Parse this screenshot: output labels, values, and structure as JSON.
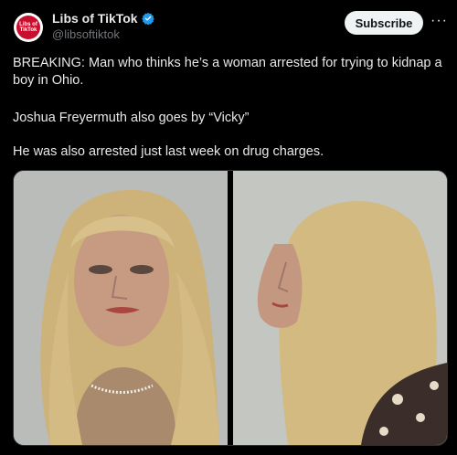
{
  "account": {
    "display_name": "Libs of TikTok",
    "handle": "@libsoftiktok",
    "avatar_text": "Libs of TikTok",
    "verified_icon": "verified-badge-icon",
    "avatar_color": "#c8102e"
  },
  "actions": {
    "subscribe_label": "Subscribe",
    "more_label": "···"
  },
  "post": {
    "line1": "BREAKING: Man who thinks he’s a woman arrested for trying to kidnap a boy in Ohio.",
    "line2": "Joshua Freyermuth also goes by “Vicky”",
    "line3": "He was also arrested just last week on drug charges."
  },
  "colors": {
    "background": "#000000",
    "text": "#e7e9ea",
    "muted": "#71767b",
    "verified": "#1d9bf0"
  }
}
